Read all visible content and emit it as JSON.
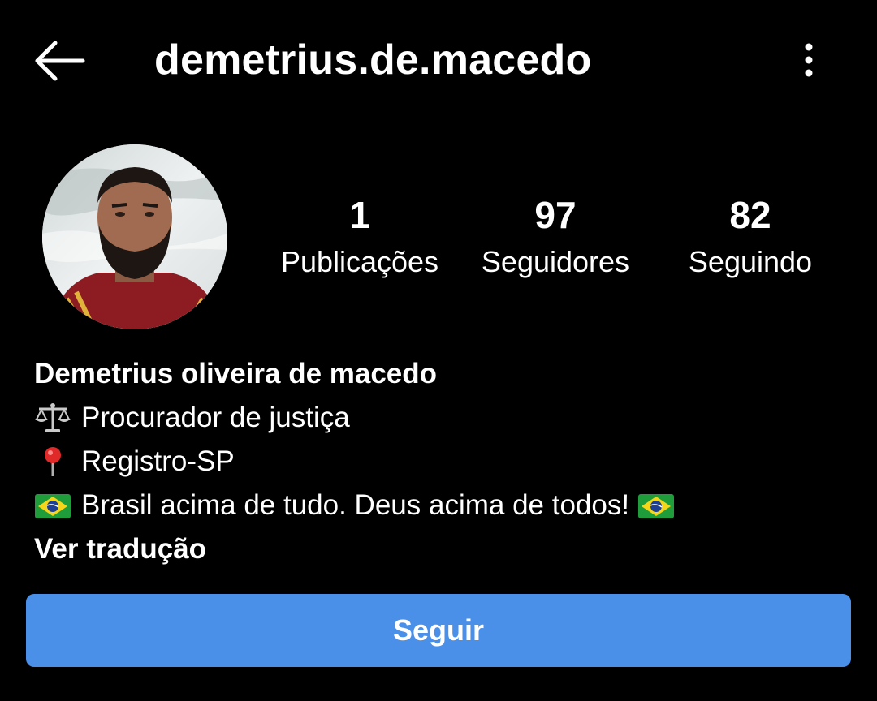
{
  "header": {
    "username": "demetrius.de.macedo",
    "back_icon": "arrow-left-icon",
    "menu_icon": "more-vertical-icon"
  },
  "profile": {
    "avatar_icon": "profile-photo",
    "stats": {
      "posts": {
        "count": "1",
        "label": "Publicações"
      },
      "followers": {
        "count": "97",
        "label": "Seguidores"
      },
      "following": {
        "count": "82",
        "label": "Seguindo"
      }
    }
  },
  "bio": {
    "name": "Demetrius oliveira de macedo",
    "lines": [
      {
        "emoji": "balance-scale-icon",
        "text": "Procurador de justiça"
      },
      {
        "emoji": "map-pin-icon",
        "text": "Registro-SP"
      },
      {
        "emoji": "brazil-flag-icon",
        "text": "Brasil acima de tudo. Deus acima de todos!",
        "trailing_emoji": "brazil-flag-icon"
      }
    ],
    "translate_link": "Ver tradução"
  },
  "actions": {
    "follow_label": "Seguir"
  },
  "colors": {
    "background": "#000000",
    "text": "#ffffff",
    "follow_button": "#4a90e8"
  }
}
